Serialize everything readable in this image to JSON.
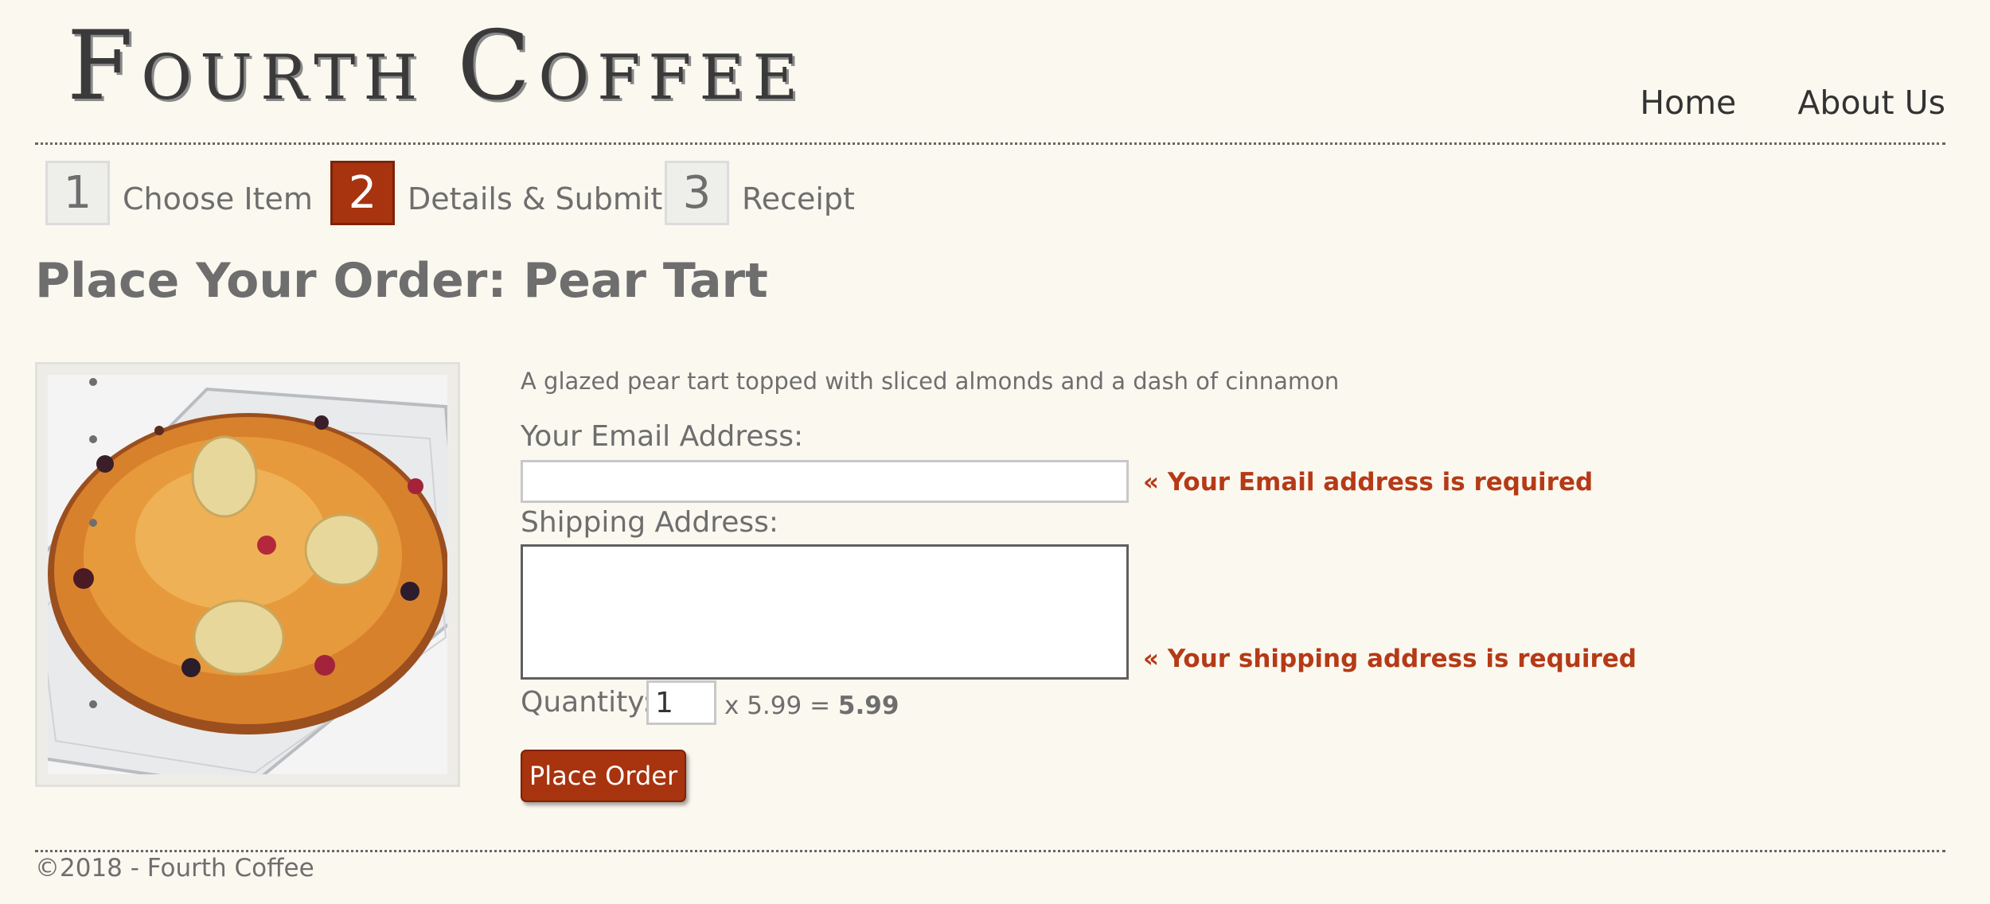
{
  "header": {
    "logo_word1": "Fourth",
    "logo_word2": "Coffee",
    "nav": [
      {
        "label": "Home"
      },
      {
        "label": "About Us"
      }
    ]
  },
  "steps": [
    {
      "number": "1",
      "label": "Choose Item",
      "active": false
    },
    {
      "number": "2",
      "label": "Details & Submit",
      "active": true
    },
    {
      "number": "3",
      "label": "Receipt",
      "active": false
    }
  ],
  "page_title": "Place Your Order: Pear Tart",
  "product": {
    "image_icon": "pear-tart-photo",
    "description": "A glazed pear tart topped with sliced almonds and a dash of cinnamon"
  },
  "form": {
    "email_label": "Your Email Address:",
    "email_value": "",
    "email_error": "« Your Email address is required",
    "shipping_label": "Shipping Address:",
    "shipping_value": "",
    "shipping_error": "« Your shipping address is required",
    "quantity_label": "Quantity:",
    "quantity_value": "1",
    "price_text": "x 5.99 =",
    "total": "5.99",
    "submit_label": "Place Order"
  },
  "footer": {
    "copyright": "©2018 - Fourth Coffee"
  },
  "colors": {
    "accent": "#a8330f",
    "error": "#b53a16",
    "background": "#fbf8f0"
  }
}
